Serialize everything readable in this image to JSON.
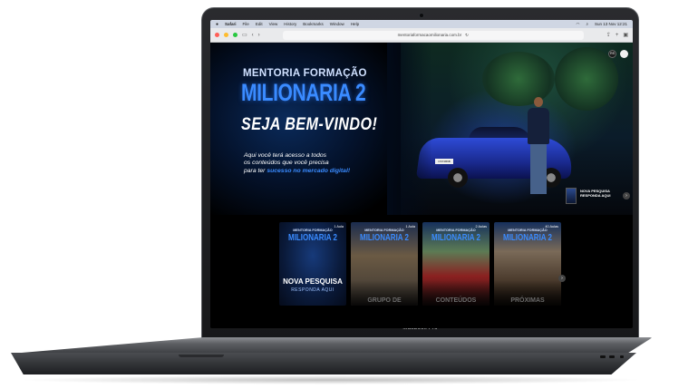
{
  "laptop": {
    "model_label": "MacBook Pro"
  },
  "menubar": {
    "apple": "",
    "app": "Safari",
    "items": [
      "File",
      "Edit",
      "View",
      "History",
      "Bookmarks",
      "Window",
      "Help"
    ],
    "datetime": "Sun 13 Nov  12:21"
  },
  "browser": {
    "url": "mentoriaformacaomilionaria.com.br"
  },
  "hero": {
    "title_line1": "MENTORIA FORMAÇÃO",
    "title_line2": "MILIONARIA 2",
    "welcome": "SEJA BEM-VINDO!",
    "desc_line1": "Aqui você terá acesso a todos",
    "desc_line2": "os conteúdos que você precisa",
    "desc_prefix": "para ter ",
    "desc_highlight": "sucesso no mercado digital!",
    "next_line1": "NOVA PESQUISA",
    "next_line2": "RESPONDA AQUI",
    "avatar_initials": "RS",
    "plate": "OST4B6B"
  },
  "cards": [
    {
      "badge": "1 Aula",
      "mini1": "MENTORIA FORMAÇÃO",
      "mini2": "MILIONARIA 2",
      "caption1": "NOVA PESQUISA",
      "caption2": "RESPONDA AQUI",
      "color": "#0a1a3a"
    },
    {
      "badge": "1 Aula",
      "mini1": "MENTORIA FORMAÇÃO",
      "mini2": "MILIONARIA 2",
      "caption": "GRUPO DE",
      "color": "#2b2a28"
    },
    {
      "badge": "2 Aulas",
      "mini1": "MENTORIA FORMAÇÃO",
      "mini2": "MILIONARIA 2",
      "caption": "CONTEÚDOS",
      "color": "#3a1a1a"
    },
    {
      "badge": "40 Aulas",
      "mini1": "MENTORIA FORMAÇÃO",
      "mini2": "MILIONARIA 2",
      "caption": "PRÓXIMAS",
      "color": "#2a1e14"
    }
  ],
  "colors": {
    "accent": "#3a8bff",
    "background": "#000000"
  }
}
